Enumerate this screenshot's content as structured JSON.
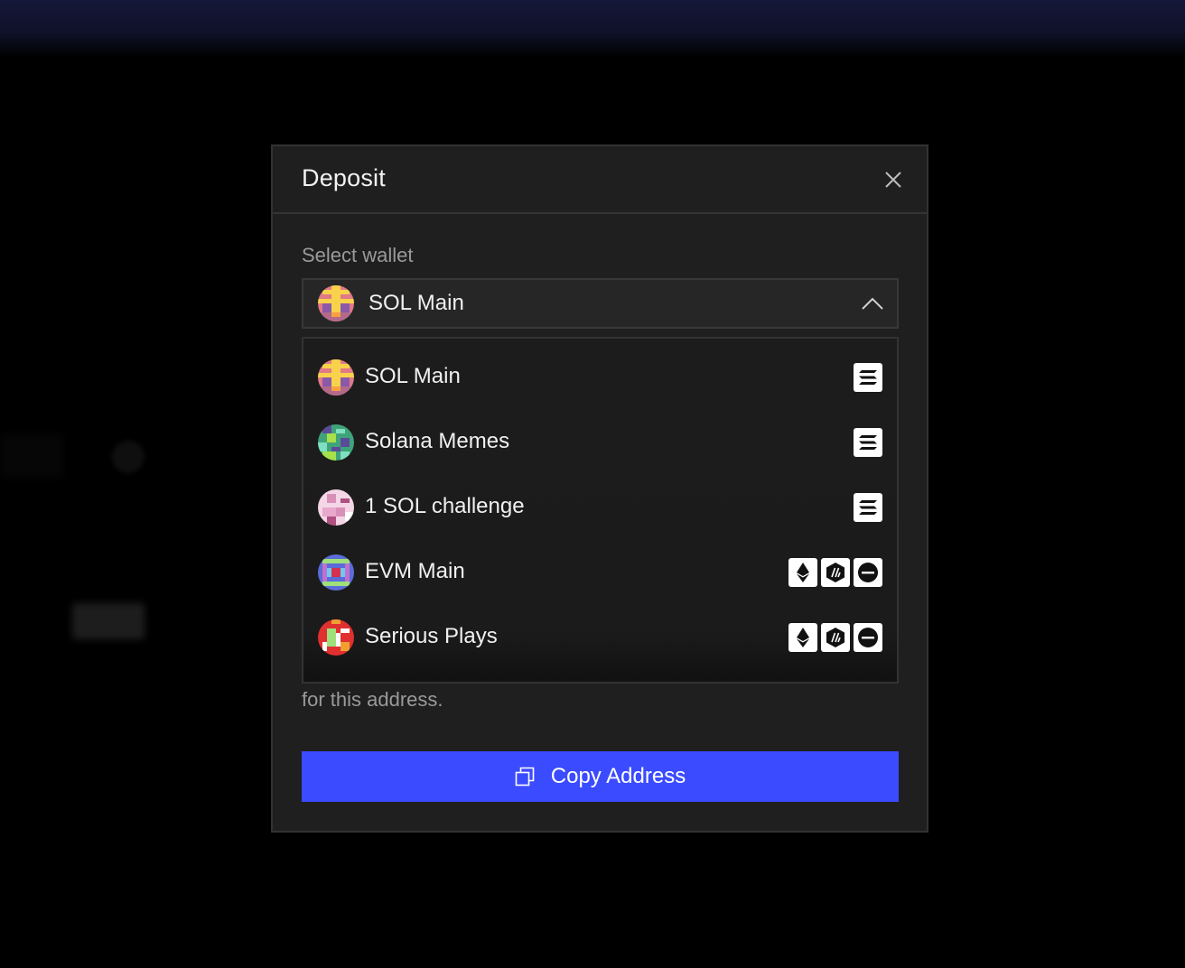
{
  "modal": {
    "title": "Deposit",
    "select_label": "Select wallet",
    "selected_wallet": "SOL Main",
    "note_text": "for this address.",
    "copy_button_label": "Copy Address"
  },
  "wallets": [
    {
      "name": "SOL Main",
      "chains": [
        "solana"
      ]
    },
    {
      "name": "Solana Memes",
      "chains": [
        "solana"
      ]
    },
    {
      "name": "1 SOL challenge",
      "chains": [
        "solana"
      ]
    },
    {
      "name": "EVM Main",
      "chains": [
        "ethereum",
        "arbitrum",
        "base"
      ]
    },
    {
      "name": "Serious Plays",
      "chains": [
        "ethereum",
        "arbitrum",
        "base"
      ]
    }
  ],
  "colors": {
    "accent": "#3b4bff",
    "modal_bg": "#1f1f1f",
    "muted_text": "#9a9a9a"
  }
}
